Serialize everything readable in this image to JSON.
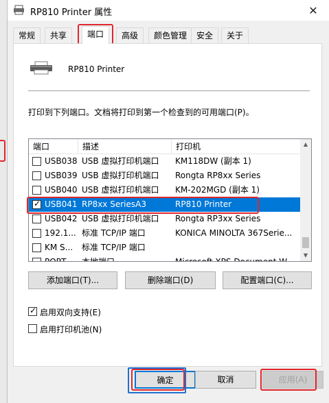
{
  "window": {
    "title": "RP810 Printer 属性",
    "close_label": "✕"
  },
  "tabs": [
    {
      "label": "常规"
    },
    {
      "label": "共享"
    },
    {
      "label": "端口"
    },
    {
      "label": "高级"
    },
    {
      "label": "颜色管理"
    },
    {
      "label": "安全"
    },
    {
      "label": "关于"
    }
  ],
  "active_tab": "端口",
  "printer": {
    "name": "RP810 Printer"
  },
  "description": "打印到下列端口。文档将打印到第一个检查到的可用端口(P)。",
  "port_list": {
    "columns": [
      "端口",
      "描述",
      "打印机"
    ],
    "rows": [
      {
        "port": "USB038",
        "desc": "USB 虚拟打印机端口",
        "printer": "KM118DW (副本 1)",
        "checked": false,
        "selected": false
      },
      {
        "port": "USB039",
        "desc": "USB 虚拟打印机端口",
        "printer": "Rongta RP8xx Series",
        "checked": false,
        "selected": false
      },
      {
        "port": "USB040",
        "desc": "USB 虚拟打印机端口",
        "printer": "KM-202MGD (副本 1)",
        "checked": false,
        "selected": false
      },
      {
        "port": "USB041",
        "desc": "RP8xx SeriesA3",
        "printer": "RP810 Printer",
        "checked": true,
        "selected": true
      },
      {
        "port": "USB042",
        "desc": "USB 虚拟打印机端口",
        "printer": "Rongta RP3xx Series",
        "checked": false,
        "selected": false
      },
      {
        "port": "192.1...",
        "desc": "标准 TCP/IP 端口",
        "printer": "KONICA MINOLTA 367Serie...",
        "checked": false,
        "selected": false
      },
      {
        "port": "KM S...",
        "desc": "标准 TCP/IP 端口",
        "printer": "",
        "checked": false,
        "selected": false
      },
      {
        "port": "PORT...",
        "desc": "本地端口",
        "printer": "Microsoft XPS Document W...",
        "checked": false,
        "selected": false
      }
    ]
  },
  "buttons": {
    "add_port": "添加端口(T)...",
    "delete_port": "删除端口(D)",
    "configure_port": "配置端口(C)..."
  },
  "options": {
    "bidirectional": {
      "label": "启用双向支持(E)",
      "checked": true
    },
    "pooling": {
      "label": "启用打印机池(N)",
      "checked": false
    }
  },
  "footer": {
    "ok": "确定",
    "cancel": "取消",
    "apply": "应用(A)"
  },
  "colors": {
    "selection": "#0078d7",
    "highlight_red": "#e0262b",
    "highlight_blue": "#1f6fce"
  }
}
